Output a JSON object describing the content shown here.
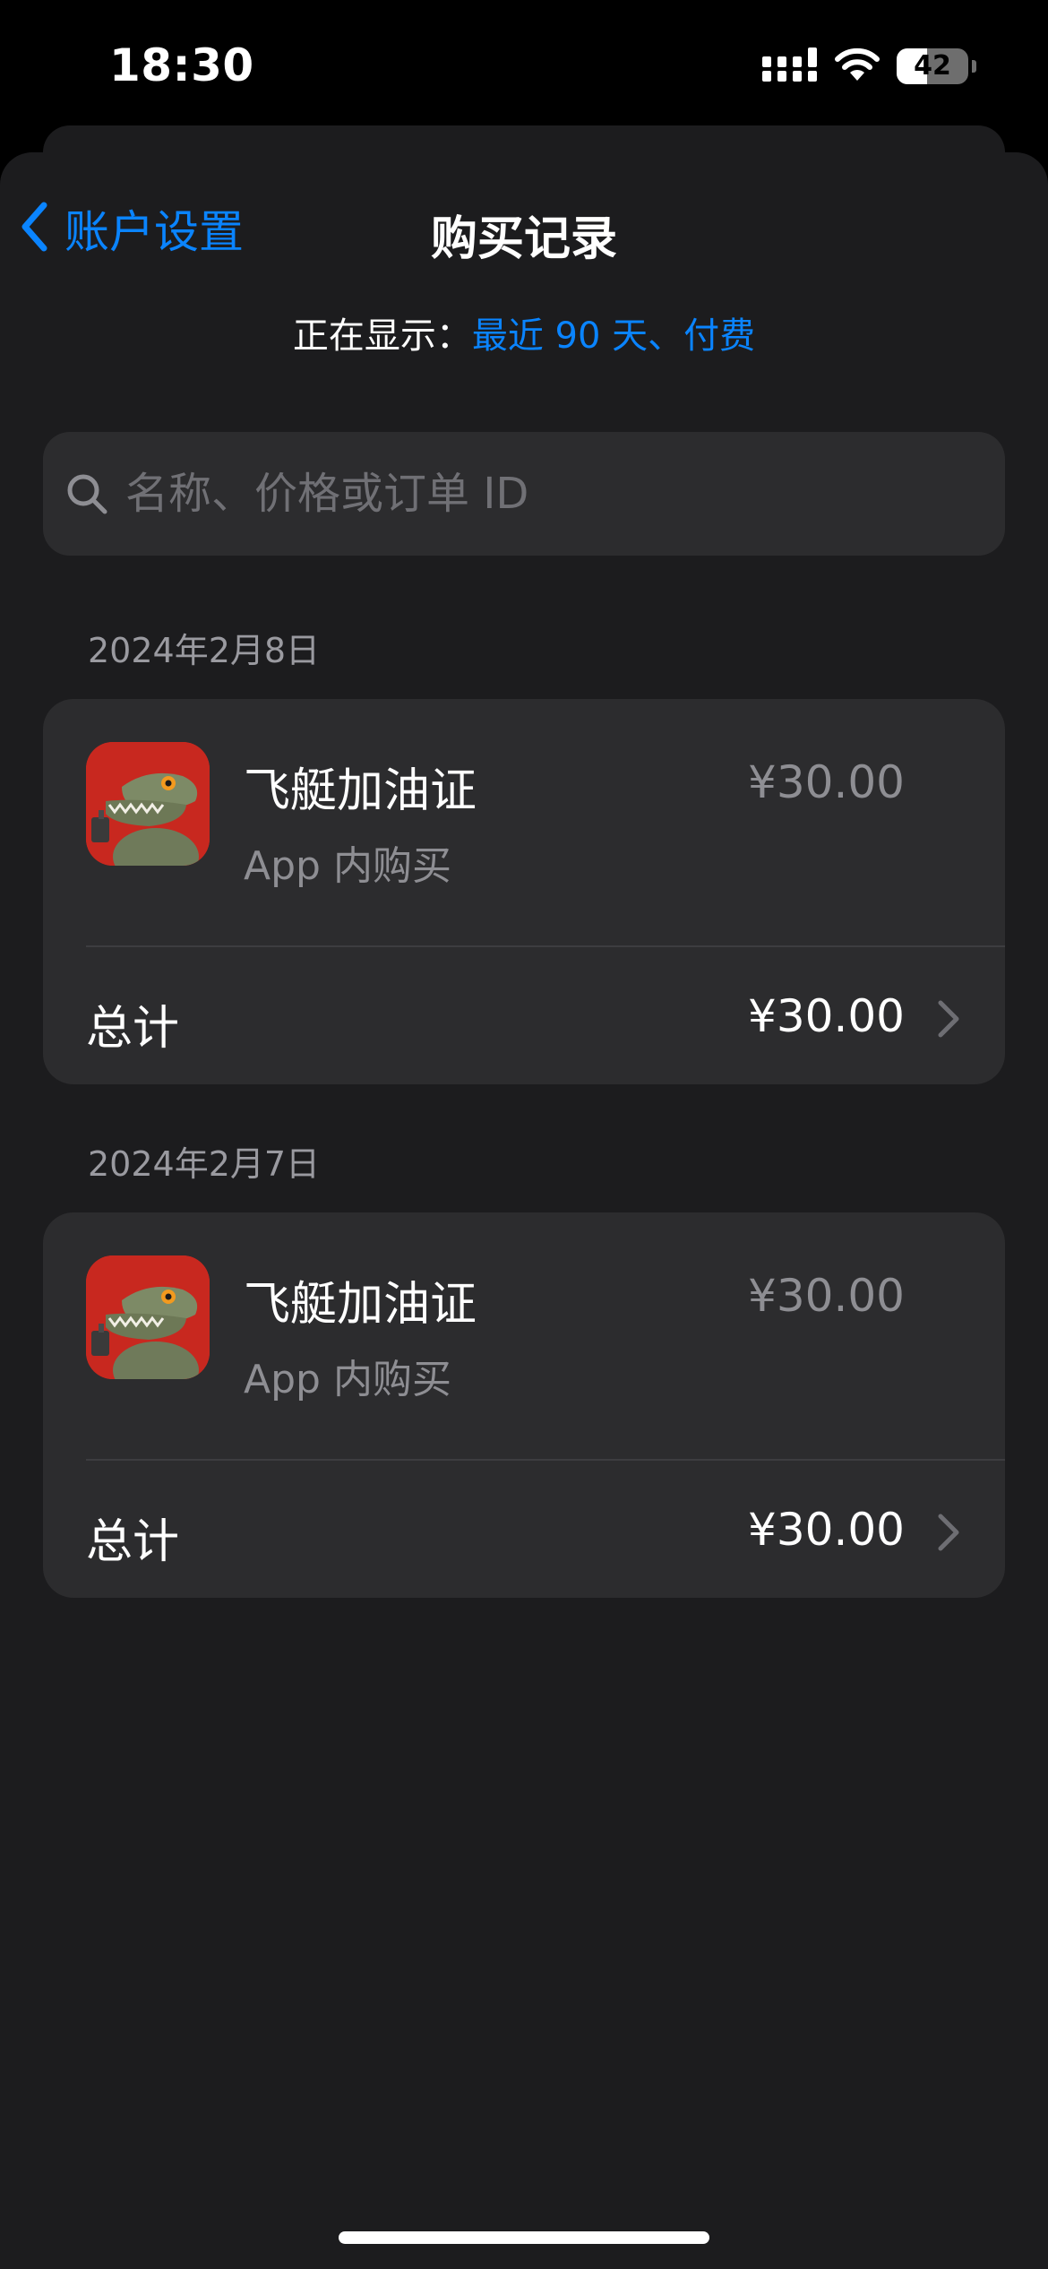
{
  "status_bar": {
    "time": "18:30",
    "battery_level": "42"
  },
  "nav": {
    "back_label": "账户设置",
    "title": "购买记录"
  },
  "filter": {
    "prefix": "正在显示：",
    "value": "最近 90 天、付费"
  },
  "search": {
    "placeholder": "名称、价格或订单 ID"
  },
  "purchase_groups": [
    {
      "date": "2024年2月8日",
      "item_name": "飞艇加油证",
      "item_type": "App 内购买",
      "item_price": "¥30.00",
      "total_label": "总计",
      "total_value": "¥30.00"
    },
    {
      "date": "2024年2月7日",
      "item_name": "飞艇加油证",
      "item_type": "App 内购买",
      "item_price": "¥30.00",
      "total_label": "总计",
      "total_value": "¥30.00"
    }
  ],
  "colors": {
    "accent": "#0a84ff",
    "sheet_background": "#1c1c1e",
    "card_background": "#2c2c2e",
    "secondary_text": "#8e8e93"
  },
  "icons": {
    "back": "chevron-left-icon",
    "search": "search-icon",
    "row_disclosure": "chevron-right-icon",
    "app": "crocodile-app-icon"
  }
}
